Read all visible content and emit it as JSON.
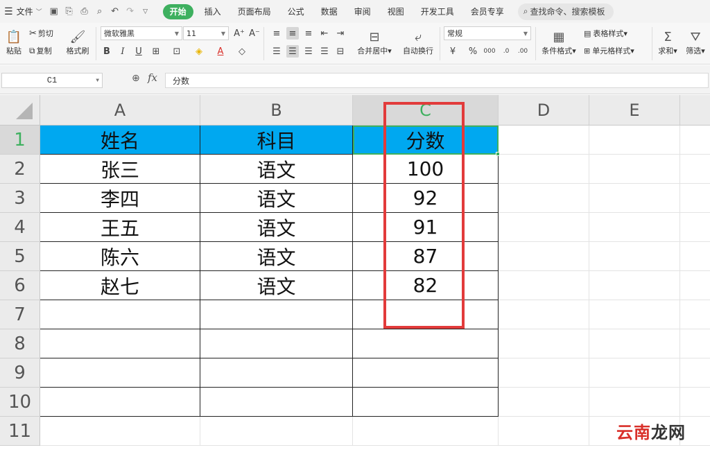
{
  "menubar": {
    "file_label": "文件",
    "tabs": [
      "开始",
      "插入",
      "页面布局",
      "公式",
      "数据",
      "审阅",
      "视图",
      "开发工具",
      "会员专享"
    ],
    "active_tab": "开始",
    "search_label": "查找命令、搜索模板"
  },
  "ribbon": {
    "paste": "粘贴",
    "cut": "剪切",
    "copy": "复制",
    "format_painter": "格式刷",
    "font_name": "微软雅黑",
    "font_size": "11",
    "merge_center": "合并居中",
    "wrap_text": "自动换行",
    "number_format": "常规",
    "conditional_format": "条件格式",
    "table_style": "表格样式",
    "cell_style": "单元格样式",
    "sum": "求和",
    "filter": "筛选"
  },
  "formula_bar": {
    "name_box": "C1",
    "fx": "fx",
    "content": "分数"
  },
  "sheet": {
    "columns": [
      "A",
      "B",
      "C",
      "D",
      "E"
    ],
    "rows": [
      "1",
      "2",
      "3",
      "4",
      "5",
      "6",
      "7",
      "8",
      "9",
      "10",
      "11"
    ],
    "selected_cell": "C1",
    "table": [
      [
        "姓名",
        "科目",
        "分数"
      ],
      [
        "张三",
        "语文",
        "100"
      ],
      [
        "李四",
        "语文",
        "92"
      ],
      [
        "王五",
        "语文",
        "91"
      ],
      [
        "陈六",
        "语文",
        "87"
      ],
      [
        "赵七",
        "语文",
        "82"
      ]
    ]
  },
  "watermark": {
    "part1": "云南",
    "part2": "龙网"
  },
  "colors": {
    "accent_green": "#3eb05f",
    "header_fill": "#00a8f0",
    "highlight_red": "#e23b3b"
  }
}
